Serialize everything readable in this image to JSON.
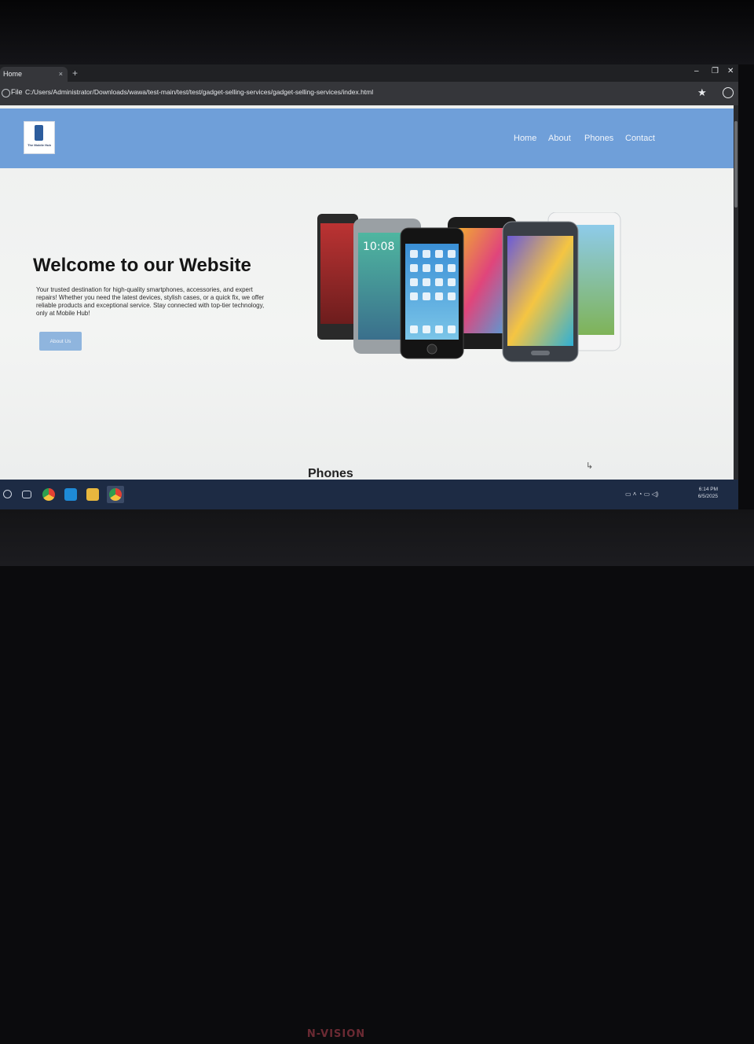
{
  "browser": {
    "tab_title": "Home",
    "tab_close": "×",
    "new_tab": "+",
    "scheme_label": "File",
    "url": "C:/Users/Administrator/Downloads/wawa/test-main/test/test/gadget-selling-services/gadget-selling-services/index.html",
    "window_controls": {
      "minimize": "–",
      "maximize": "❐",
      "close": "✕"
    },
    "bookmark_icon": "★"
  },
  "site": {
    "logo_text": "The Mobile Hub",
    "nav": [
      "Home",
      "About",
      "Phones",
      "Contact"
    ],
    "hero": {
      "title": "Welcome to our Website",
      "description": "Your trusted destination for high-quality smartphones, accessories, and expert repairs! Whether you need the latest devices, stylish cases, or a quick fix, we offer reliable products and exceptional service. Stay connected with top-tier technology, only at Mobile Hub!",
      "button": "About Us"
    },
    "phones_section_title": "Phones"
  },
  "taskbar": {
    "apps": [
      "search-icon",
      "task-view-icon",
      "chrome-icon",
      "vscode-icon",
      "file-explorer-icon",
      "chrome-active-icon"
    ],
    "time": "6:14 PM",
    "date": "6/5/2025"
  },
  "monitor_brand": "N-VISION",
  "colors": {
    "header": "#6f9fd9",
    "button": "#8fb5de",
    "taskbar": "#1d2b44"
  }
}
